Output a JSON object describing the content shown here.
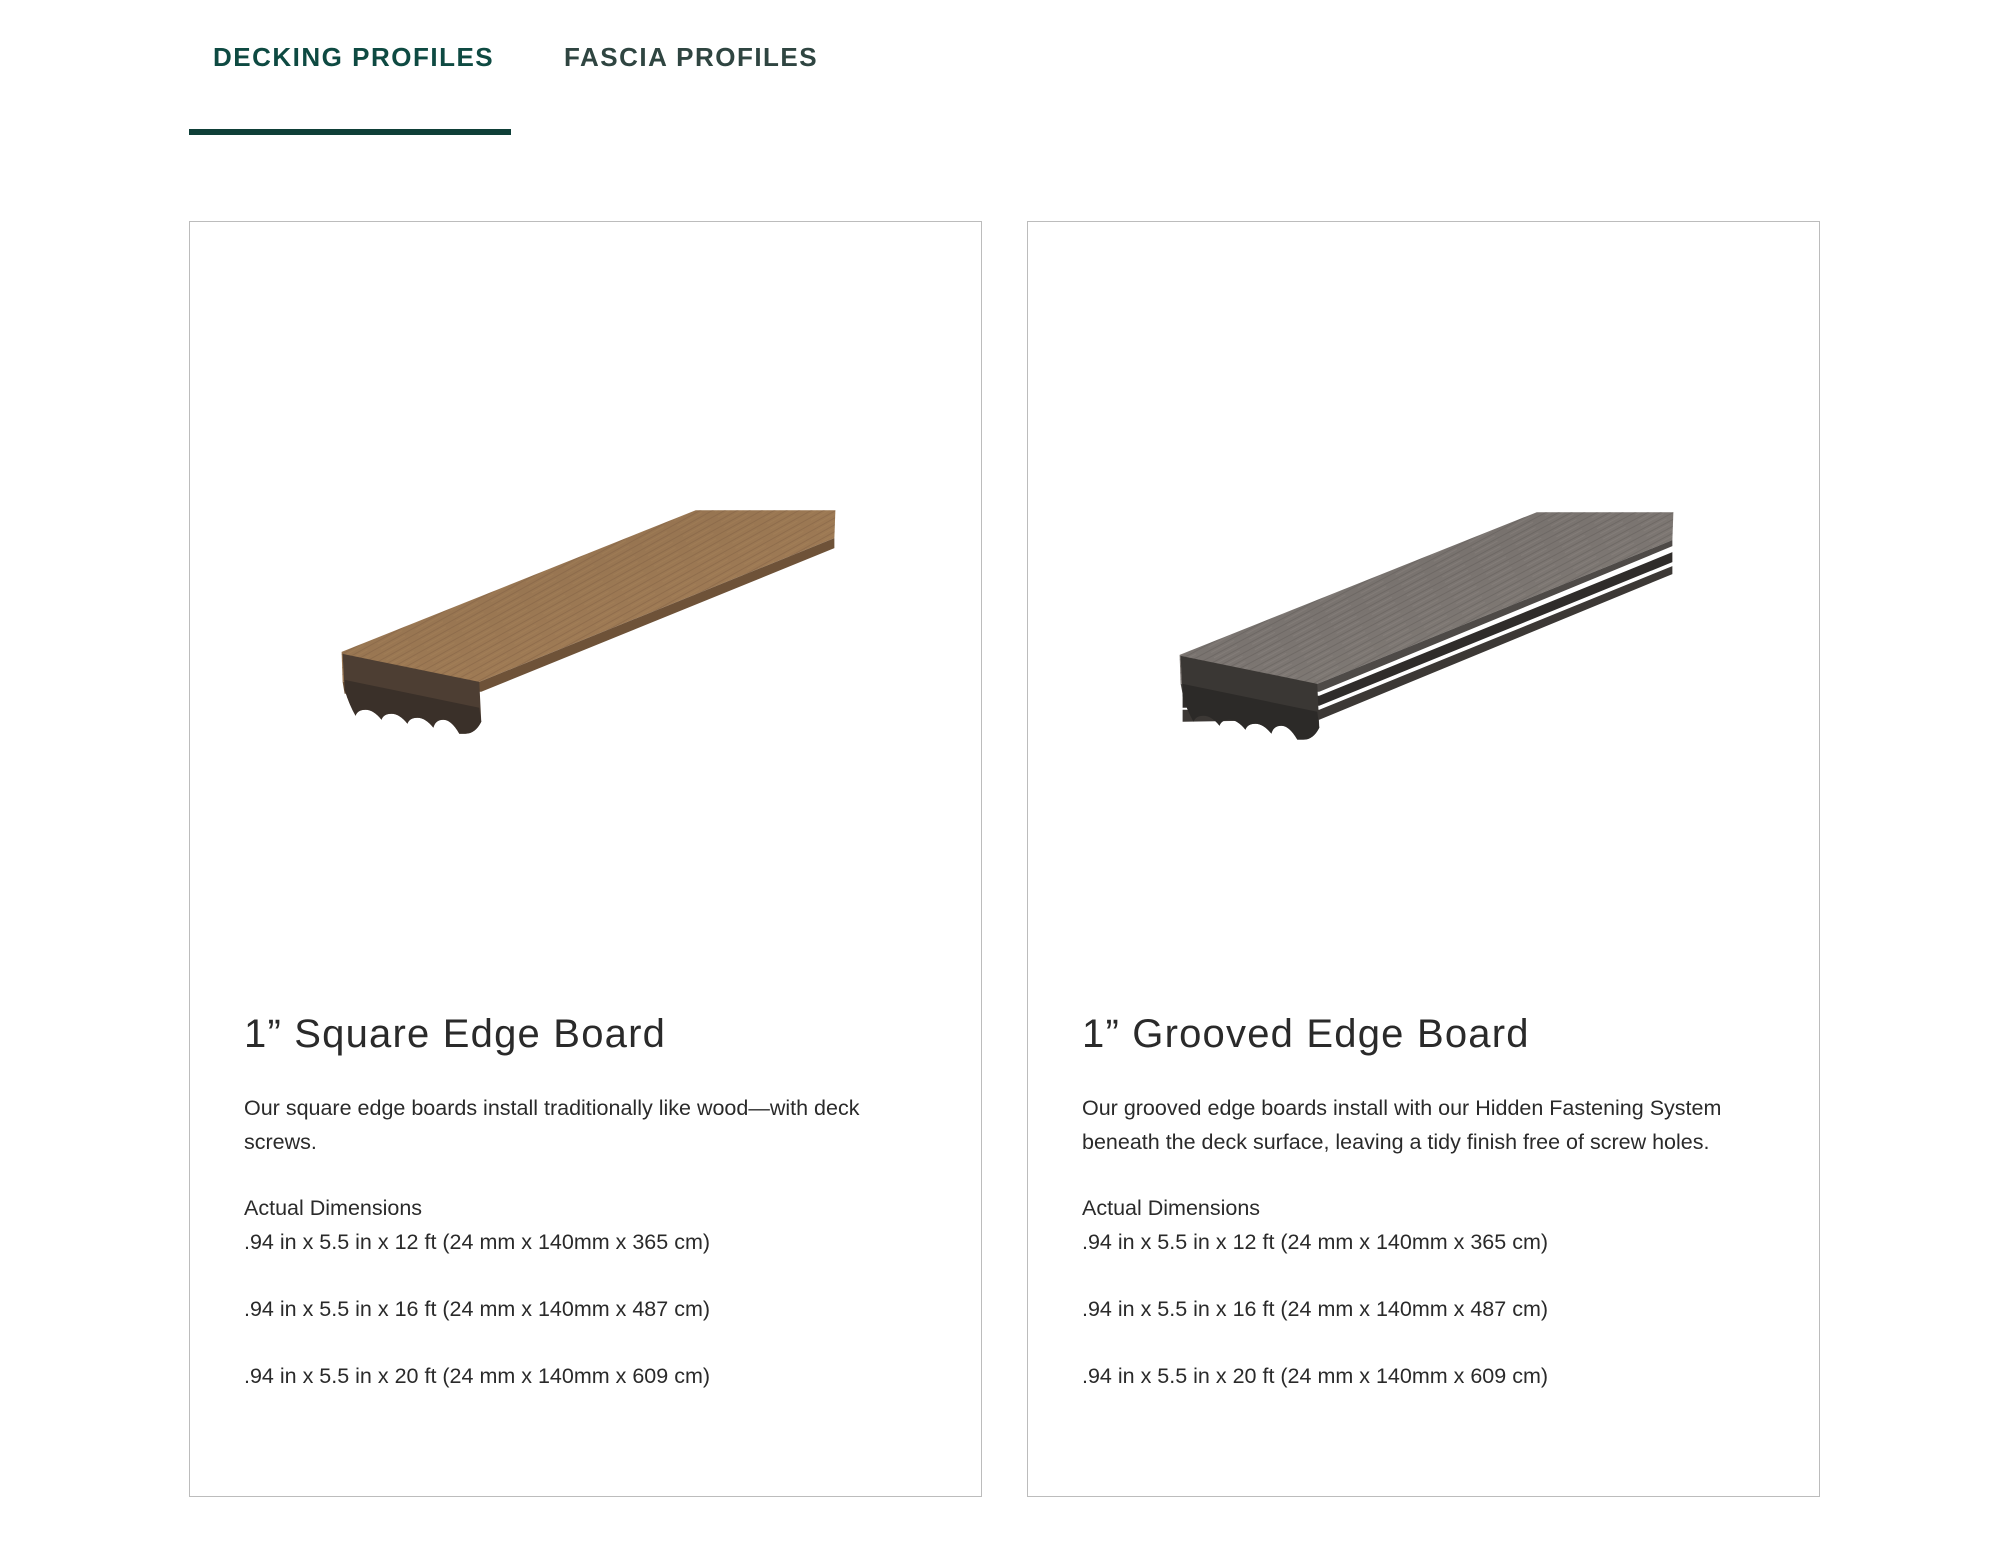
{
  "tabs": {
    "decking": "DECKING PROFILES",
    "fascia": "FASCIA PROFILES"
  },
  "colors": {
    "accent": "#0f3f38",
    "active_tab": "#0e4a42",
    "card_border": "#bcbcbc"
  },
  "cards": [
    {
      "title": "1” Square Edge Board",
      "description": "Our square edge boards install traditionally like wood—with deck screws.",
      "dimensions_heading": "Actual Dimensions",
      "dimensions": [
        ".94 in x 5.5 in x 12 ft (24 mm x 140mm x 365 cm)",
        ".94 in x 5.5 in x 16 ft (24 mm x 140mm x 487 cm)",
        ".94 in x 5.5 in x 20 ft (24 mm x 140mm x 609 cm)"
      ],
      "board_color": "brown-wood"
    },
    {
      "title": "1” Grooved Edge Board",
      "description": "Our grooved edge boards install with our Hidden Fastening System beneath the deck surface, leaving a tidy finish free of screw holes.",
      "dimensions_heading": "Actual Dimensions",
      "dimensions": [
        ".94 in x 5.5 in x 12 ft (24 mm x 140mm x 365 cm)",
        ".94 in x 5.5 in x 16 ft (24 mm x 140mm x 487 cm)",
        ".94 in x 5.5 in x 20 ft (24 mm x 140mm x 609 cm)"
      ],
      "board_color": "gray-wood"
    }
  ]
}
